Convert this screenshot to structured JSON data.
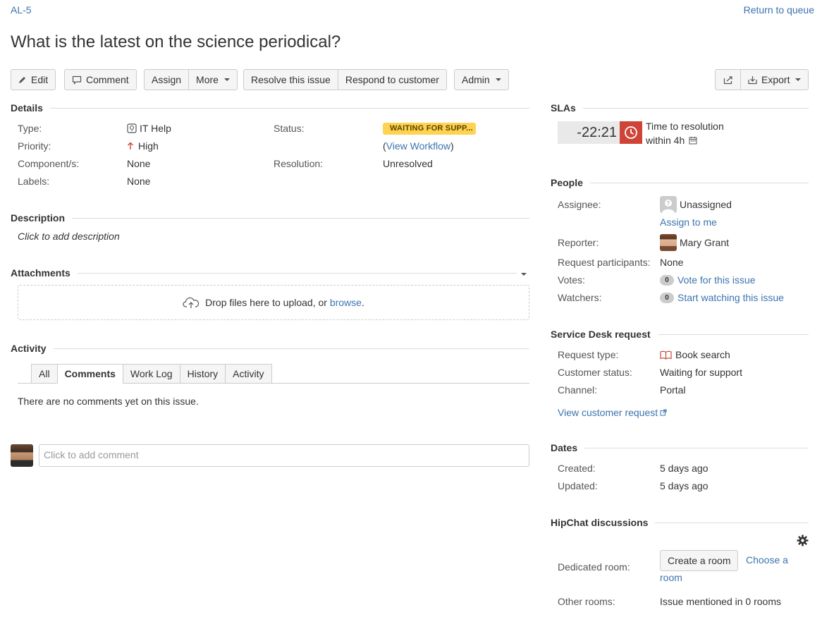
{
  "header": {
    "issue_key": "AL-5",
    "return_link": "Return to queue",
    "summary": "What is the latest on the science periodical?"
  },
  "toolbar": {
    "edit": "Edit",
    "comment": "Comment",
    "assign": "Assign",
    "more": "More",
    "resolve": "Resolve this issue",
    "respond": "Respond to customer",
    "admin": "Admin",
    "export": "Export"
  },
  "details": {
    "heading": "Details",
    "type_label": "Type:",
    "type_value": "IT Help",
    "priority_label": "Priority:",
    "priority_value": "High",
    "components_label": "Component/s:",
    "components_value": "None",
    "labels_label": "Labels:",
    "labels_value": "None",
    "status_label": "Status:",
    "status_value": "WAITING FOR SUPP...",
    "workflow_open": "(",
    "workflow_link": "View Workflow",
    "workflow_close": ")",
    "resolution_label": "Resolution:",
    "resolution_value": "Unresolved"
  },
  "description": {
    "heading": "Description",
    "placeholder": "Click to add description"
  },
  "attachments": {
    "heading": "Attachments",
    "drop_text": "Drop files here to upload, or",
    "browse": "browse",
    "period": "."
  },
  "activity": {
    "heading": "Activity",
    "tabs": [
      "All",
      "Comments",
      "Work Log",
      "History",
      "Activity"
    ],
    "empty": "There are no comments yet on this issue.",
    "comment_placeholder": "Click to add comment"
  },
  "slas": {
    "heading": "SLAs",
    "time": "-22:21",
    "name": "Time to resolution",
    "goal": "within 4h"
  },
  "people": {
    "heading": "People",
    "assignee_label": "Assignee:",
    "assignee_value": "Unassigned",
    "assign_to_me": "Assign to me",
    "reporter_label": "Reporter:",
    "reporter_value": "Mary Grant",
    "participants_label": "Request participants:",
    "participants_value": "None",
    "votes_label": "Votes:",
    "votes_count": "0",
    "votes_link": "Vote for this issue",
    "watchers_label": "Watchers:",
    "watchers_count": "0",
    "watchers_link": "Start watching this issue"
  },
  "service_desk": {
    "heading": "Service Desk request",
    "request_type_label": "Request type:",
    "request_type_value": "Book search",
    "customer_status_label": "Customer status:",
    "customer_status_value": "Waiting for support",
    "channel_label": "Channel:",
    "channel_value": "Portal",
    "view_request": "View customer request"
  },
  "dates": {
    "heading": "Dates",
    "created_label": "Created:",
    "created_value": "5 days ago",
    "updated_label": "Updated:",
    "updated_value": "5 days ago"
  },
  "hipchat": {
    "heading": "HipChat discussions",
    "dedicated_label": "Dedicated room:",
    "create_room": "Create a room",
    "choose_room_1": "Choose a",
    "choose_room_2": "room",
    "other_label": "Other rooms:",
    "other_value": "Issue mentioned in 0 rooms"
  },
  "colors": {
    "link": "#3b73af",
    "status_yellow": "#ffd351",
    "sla_red": "#d04437"
  }
}
